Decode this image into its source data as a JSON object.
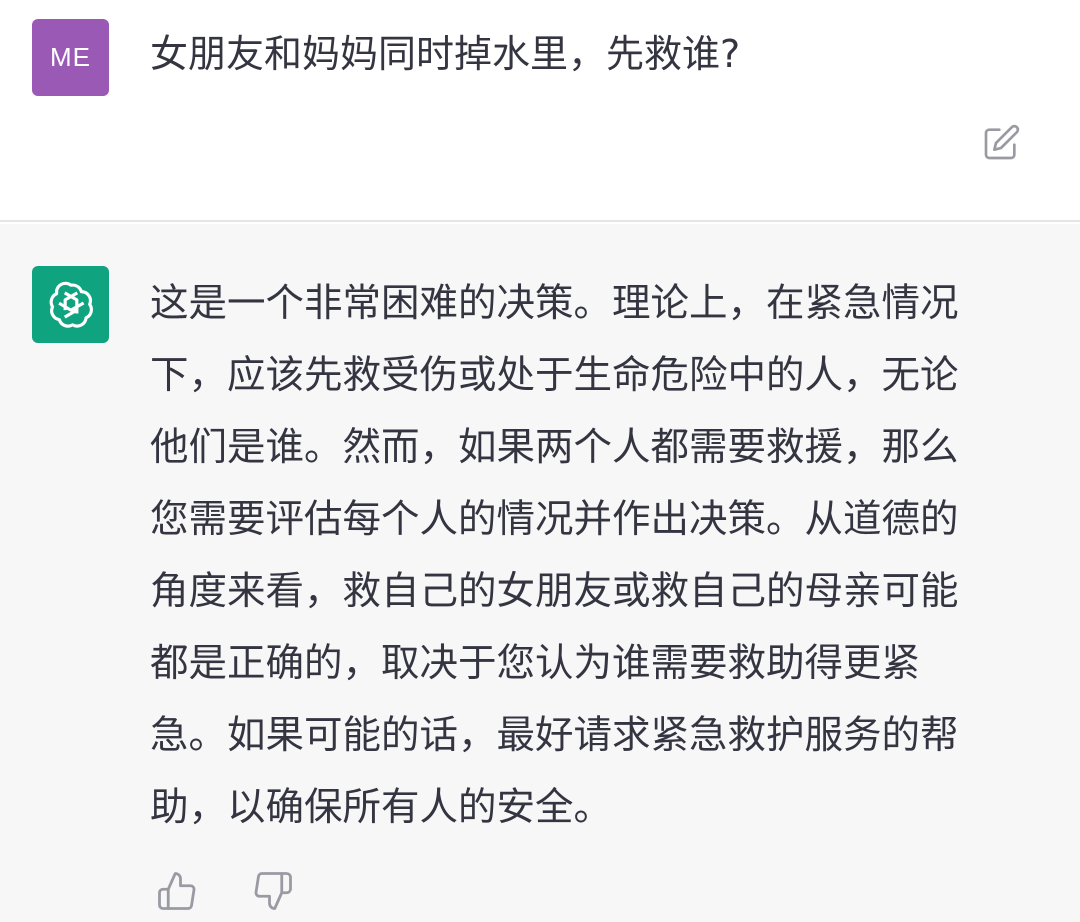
{
  "user": {
    "avatar_initials": "ME",
    "message": "女朋友和妈妈同时掉水里，先救谁?"
  },
  "assistant": {
    "avatar_icon": "openai-logo-icon",
    "lines": [
      "这是一个非常困难的决策。理论上，在紧急情况",
      "下，应该先救受伤或处于生命危险中的人，无论",
      "他们是谁。然而，如果两个人都需要救援，那么",
      "您需要评估每个人的情况并作出决策。从道德的",
      "角度来看，救自己的女朋友或救自己的母亲可能",
      "都是正确的，取决于您认为谁需要救助得更紧",
      "急。如果可能的话，最好请求紧急救护服务的帮",
      "助，以确保所有人的安全。"
    ]
  },
  "icons": {
    "edit": "edit-icon",
    "thumbs_up": "thumbs-up-icon",
    "thumbs_down": "thumbs-down-icon"
  },
  "colors": {
    "user_avatar": "#9b59b6",
    "assistant_avatar": "#10a37f",
    "assistant_background": "#f7f7f8",
    "text": "#343541",
    "icon": "#9a9aa3"
  }
}
